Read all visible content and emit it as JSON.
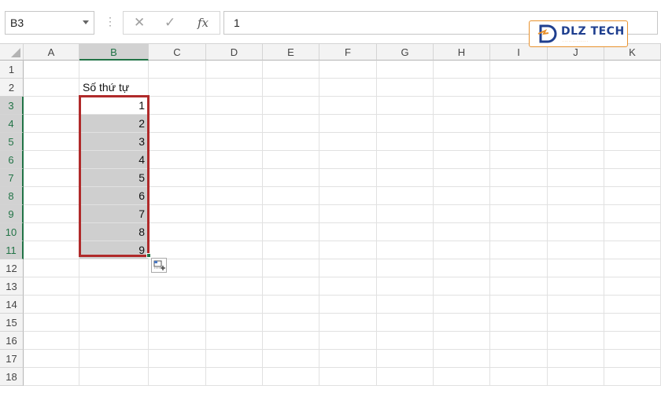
{
  "name_box": {
    "value": "B3"
  },
  "formula_bar": {
    "content": "1",
    "cancel_icon": "✕",
    "enter_icon": "✓",
    "fx_label": "fx"
  },
  "logo": {
    "brand": "DLZ TECH"
  },
  "columns": [
    "A",
    "B",
    "C",
    "D",
    "E",
    "F",
    "G",
    "H",
    "I",
    "J",
    "K"
  ],
  "selected_column": "B",
  "rows": [
    "1",
    "2",
    "3",
    "4",
    "5",
    "6",
    "7",
    "8",
    "9",
    "10",
    "11",
    "12",
    "13",
    "14",
    "15",
    "16",
    "17",
    "18"
  ],
  "selected_rows": [
    "3",
    "4",
    "5",
    "6",
    "7",
    "8",
    "9",
    "10",
    "11"
  ],
  "cells": {
    "B2": "Số thứ tự",
    "B3": "1",
    "B4": "2",
    "B5": "3",
    "B6": "4",
    "B7": "5",
    "B8": "6",
    "B9": "7",
    "B10": "8",
    "B11": "9"
  },
  "colors": {
    "selection_border": "#b02a2a",
    "header_accent": "#217346",
    "logo_accent": "#e8922e",
    "logo_text": "#1f3f8f"
  }
}
